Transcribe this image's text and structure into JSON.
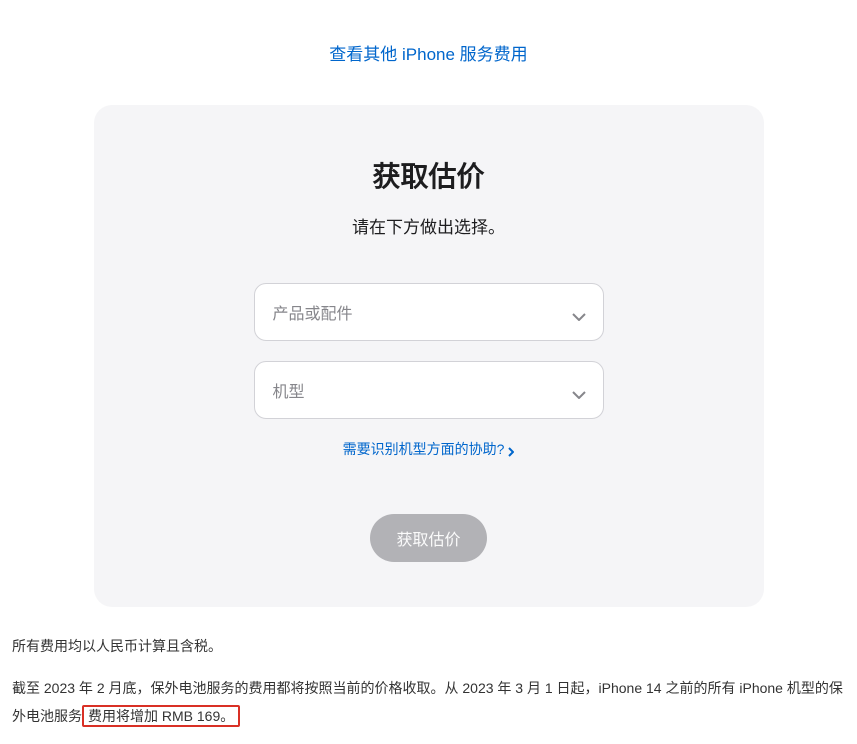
{
  "top_link": {
    "label": "查看其他 iPhone 服务费用"
  },
  "card": {
    "title": "获取估价",
    "subtitle": "请在下方做出选择。",
    "select_product_placeholder": "产品或配件",
    "select_model_placeholder": "机型",
    "help_link_label": "需要识别机型方面的协助?",
    "submit_label": "获取估价"
  },
  "notes": {
    "line1": "所有费用均以人民币计算且含税。",
    "line2_prefix": "截至 2023 年 2 月底，保外电池服务的费用都将按照当前的价格收取。从 2023 年 3 月 1 日起，iPhone 14 之前的所有 iPhone 机型的保外电池服务",
    "line2_highlighted": "费用将增加 RMB 169。"
  }
}
